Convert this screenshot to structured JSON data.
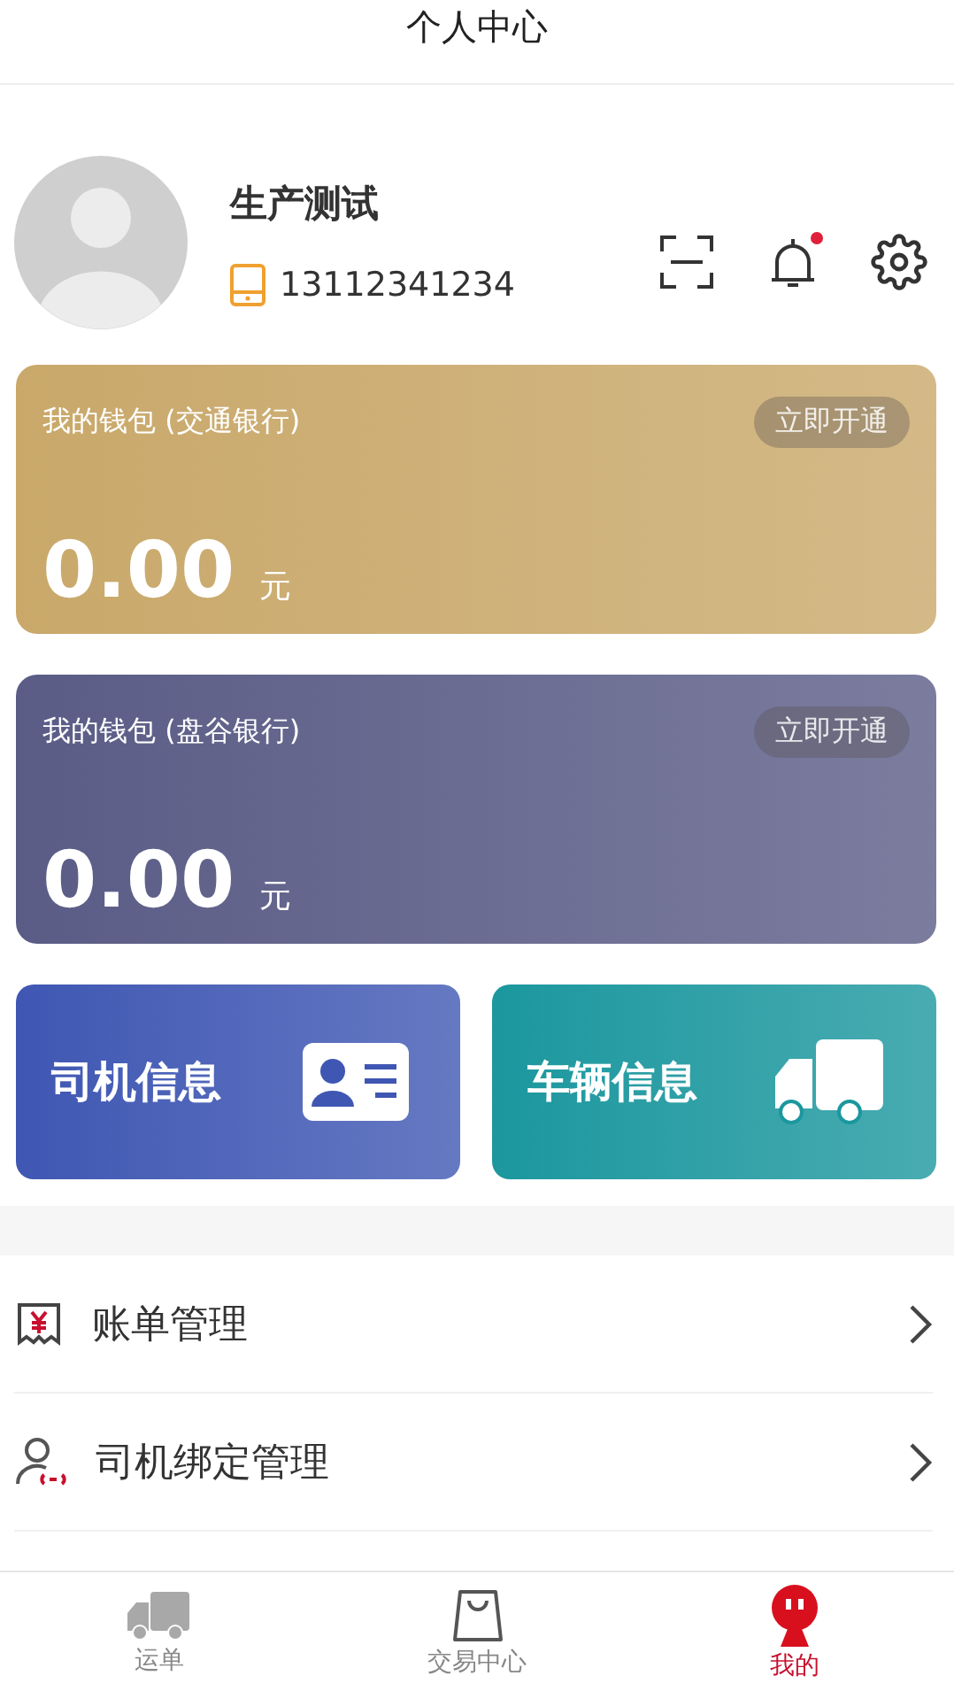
{
  "header": {
    "title": "个人中心"
  },
  "profile": {
    "name": "生产测试",
    "phone": "13112341234",
    "has_notification": true
  },
  "wallets": [
    {
      "title": "我的钱包 (交通银行)",
      "action": "立即开通",
      "amount": "0.00",
      "unit": "元",
      "color": "#c9a86a"
    },
    {
      "title": "我的钱包 (盘谷银行)",
      "action": "立即开通",
      "amount": "0.00",
      "unit": "元",
      "color": "#5a5c86"
    }
  ],
  "quick_cards": [
    {
      "label": "司机信息",
      "kind": "id-card",
      "color": "#3f57b3"
    },
    {
      "label": "车辆信息",
      "kind": "truck",
      "color": "#1b979e"
    }
  ],
  "menu": [
    {
      "label": "账单管理",
      "kind": "bill"
    },
    {
      "label": "司机绑定管理",
      "kind": "bind"
    }
  ],
  "bottom_nav": [
    {
      "label": "运单",
      "kind": "truck",
      "selected": false
    },
    {
      "label": "交易中心",
      "kind": "bag",
      "selected": false
    },
    {
      "label": "我的",
      "kind": "me",
      "selected": true
    }
  ]
}
